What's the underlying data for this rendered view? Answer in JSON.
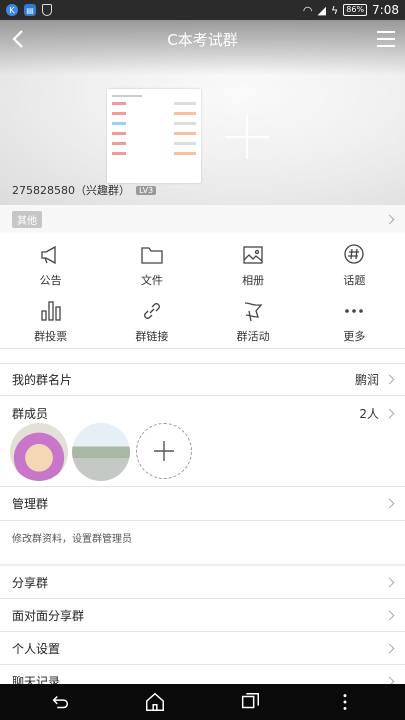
{
  "status": {
    "time": "7:08",
    "battery": "86%"
  },
  "header": {
    "title": "C本考试群"
  },
  "group": {
    "id_line": "275828580（兴趣群）",
    "level_badge": "LV3",
    "tag": "其他"
  },
  "grid": [
    {
      "label": "公告",
      "icon": "megaphone-icon"
    },
    {
      "label": "文件",
      "icon": "folder-icon"
    },
    {
      "label": "相册",
      "icon": "photo-icon"
    },
    {
      "label": "话题",
      "icon": "hashtag-icon"
    },
    {
      "label": "群投票",
      "icon": "bar-chart-icon"
    },
    {
      "label": "群链接",
      "icon": "link-icon"
    },
    {
      "label": "群活动",
      "icon": "flag-icon"
    },
    {
      "label": "更多",
      "icon": "more-icon"
    }
  ],
  "card": {
    "label": "我的群名片",
    "value": "鹏润"
  },
  "members": {
    "label": "群成员",
    "count": "2人"
  },
  "manage": {
    "label": "管理群",
    "desc": "修改群资料，设置群管理员"
  },
  "list": [
    {
      "label": "分享群"
    },
    {
      "label": "面对面分享群"
    },
    {
      "label": "个人设置"
    },
    {
      "label": "聊天记录"
    }
  ]
}
